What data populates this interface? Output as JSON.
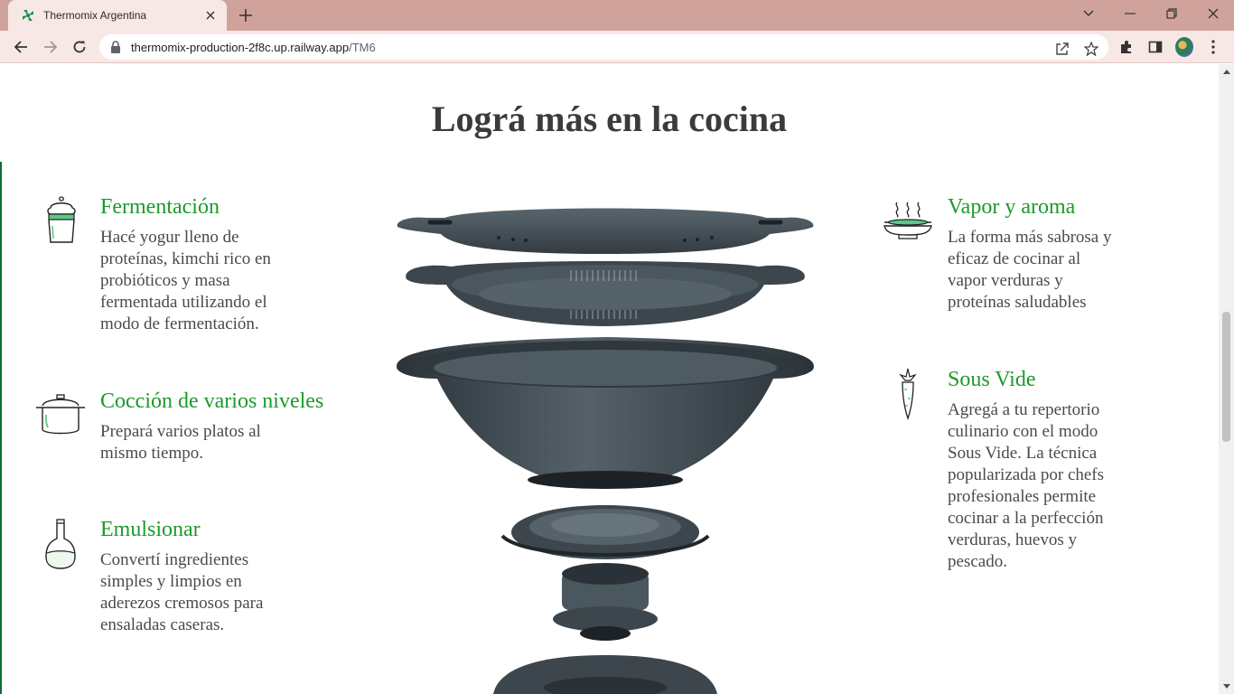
{
  "browser": {
    "tab_title": "Thermomix Argentina",
    "url_host": "thermomix-production-2f8c.up.railway.app",
    "url_path": "/TM6"
  },
  "page": {
    "heading": "Lográ más en la cocina"
  },
  "features_left": [
    {
      "icon": "yogurt-cup-icon",
      "title": "Fermentación",
      "desc": [
        "Hacé yogur lleno de",
        "proteínas, kimchi rico en",
        "probióticos y masa",
        "fermentada utilizando el",
        "modo de fermentación."
      ]
    },
    {
      "icon": "cooking-pot-icon",
      "title": "Cocción de varios niveles",
      "desc": [
        "Prepará varios platos al",
        "mismo tiempo."
      ]
    },
    {
      "icon": "flask-icon",
      "title": "Emulsionar",
      "desc": [
        "Convertí ingredientes",
        "simples y limpios en",
        "aderezos cremosos para",
        "ensaladas caseras."
      ]
    }
  ],
  "features_right": [
    {
      "icon": "steam-bowl-icon",
      "title": "Vapor y aroma",
      "desc": [
        "La forma más sabrosa y",
        "eficaz de cocinar al",
        "vapor verduras y",
        "proteínas saludables"
      ]
    },
    {
      "icon": "carrot-icon",
      "title": "Sous Vide",
      "desc": [
        "Agregá a tu repertorio",
        "culinario con el modo",
        "Sous Vide. La técnica",
        "popularizada por chefs",
        "profesionales permite",
        "cocinar a la perfección",
        "verduras, huevos y",
        "pescado."
      ]
    }
  ],
  "colors": {
    "accent_green": "#1c9a2b",
    "tab_bar": "#cfa39b",
    "toolbar": "#f8e8e5",
    "product_gray": "#3c464c"
  }
}
